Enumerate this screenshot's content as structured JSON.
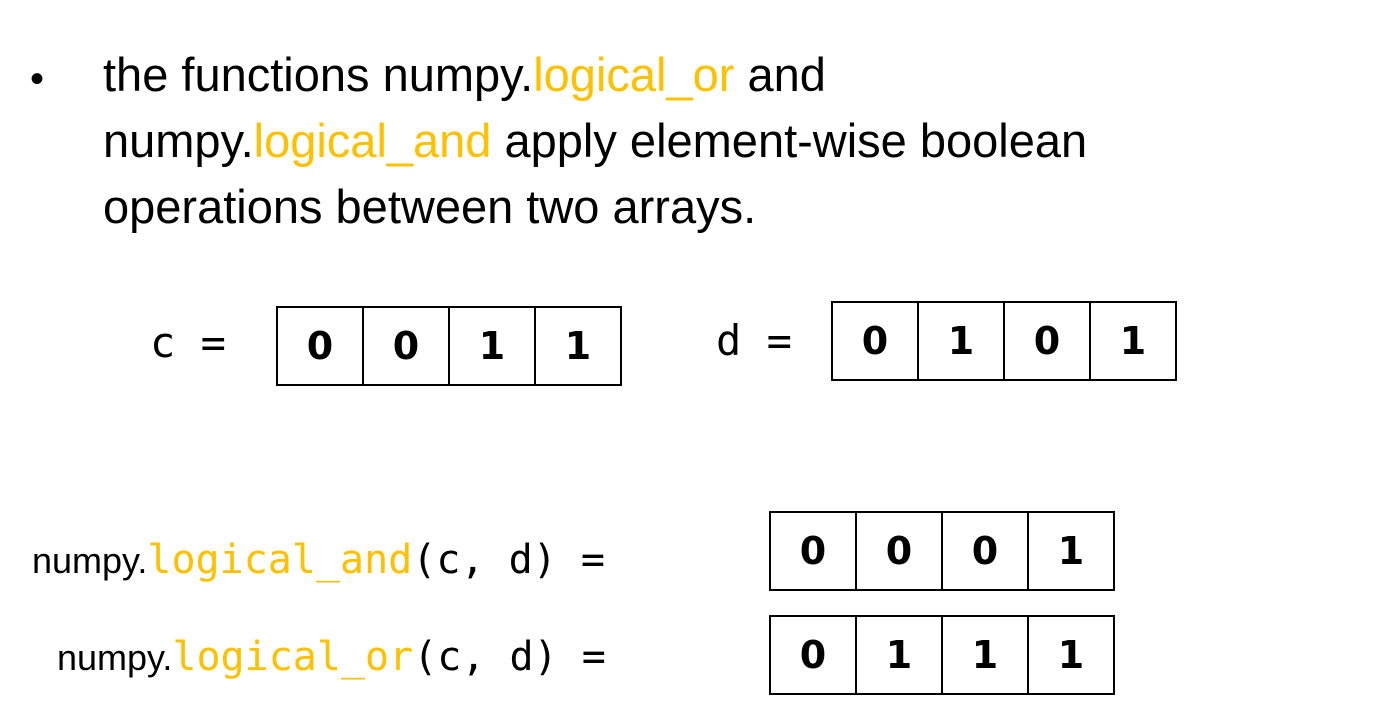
{
  "bullet": {
    "marker": "•",
    "line1": {
      "prefix": "the functions numpy.",
      "highlight": "logical_or",
      "suffix": " and"
    },
    "line2": {
      "prefix": "numpy.",
      "highlight": "logical_and",
      "suffix": " apply element-wise boolean"
    },
    "line3": {
      "text": "operations between two arrays."
    }
  },
  "arrays": {
    "c": {
      "label": "c =",
      "values": [
        "0",
        "0",
        "1",
        "1"
      ]
    },
    "d": {
      "label": "d =",
      "values": [
        "0",
        "1",
        "0",
        "1"
      ]
    }
  },
  "results": {
    "and": {
      "prefix": "numpy.",
      "func": "logical_and",
      "args": "(c, d) =",
      "values": [
        "0",
        "0",
        "0",
        "1"
      ]
    },
    "or": {
      "prefix": "numpy.",
      "func": "logical_or",
      "args": "(c, d) =",
      "values": [
        "0",
        "1",
        "1",
        "1"
      ]
    }
  },
  "colors": {
    "highlight": "#FFC000",
    "text": "#000000",
    "border": "#000000"
  }
}
